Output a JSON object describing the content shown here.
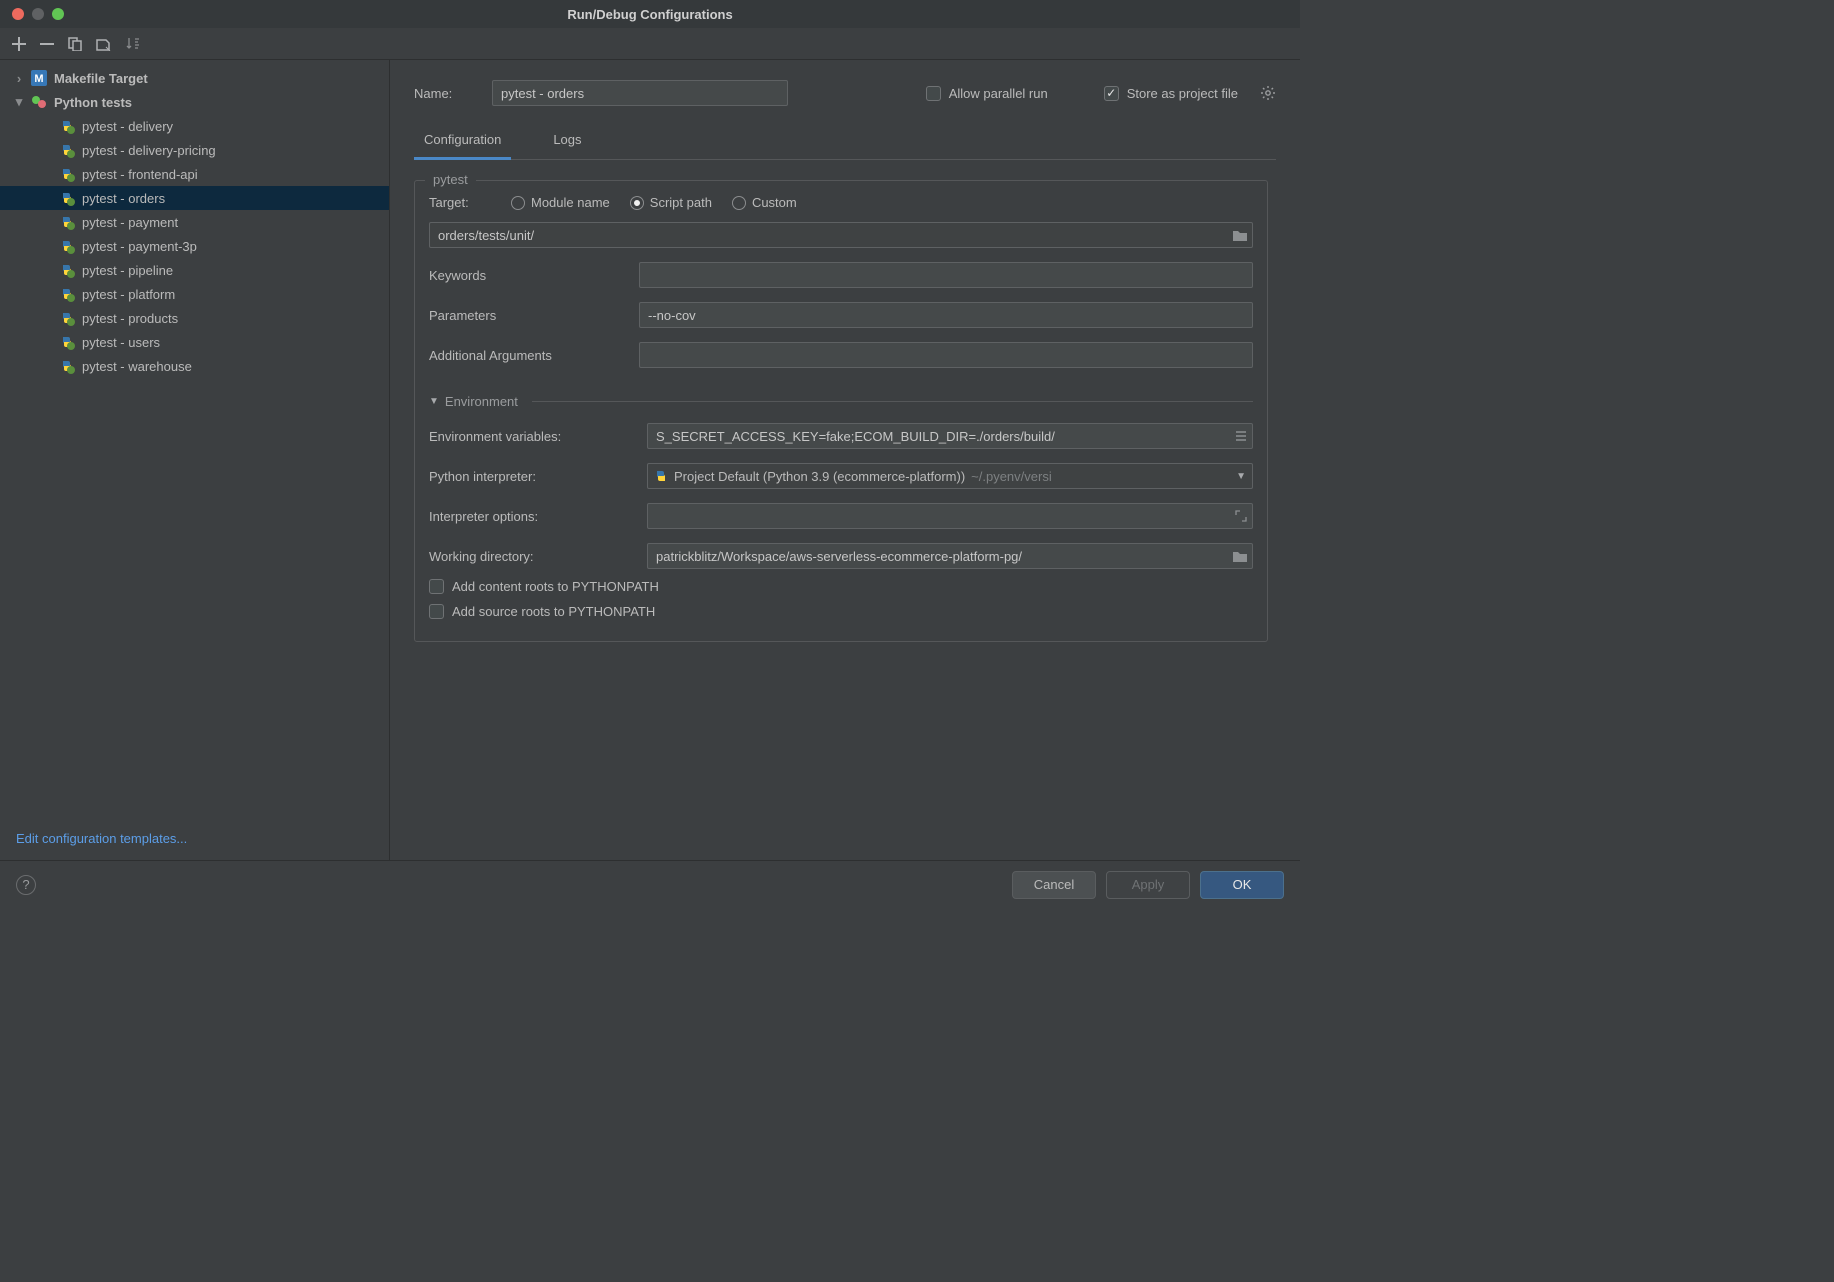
{
  "window": {
    "title": "Run/Debug Configurations"
  },
  "sidebar": {
    "groups": [
      {
        "label": "Makefile Target",
        "expanded": false,
        "icon": "makefile"
      },
      {
        "label": "Python tests",
        "expanded": true,
        "icon": "pytests",
        "items": [
          {
            "label": "pytest - delivery",
            "selected": false
          },
          {
            "label": "pytest - delivery-pricing",
            "selected": false
          },
          {
            "label": "pytest - frontend-api",
            "selected": false
          },
          {
            "label": "pytest - orders",
            "selected": true
          },
          {
            "label": "pytest - payment",
            "selected": false
          },
          {
            "label": "pytest - payment-3p",
            "selected": false
          },
          {
            "label": "pytest - pipeline",
            "selected": false
          },
          {
            "label": "pytest - platform",
            "selected": false
          },
          {
            "label": "pytest - products",
            "selected": false
          },
          {
            "label": "pytest - users",
            "selected": false
          },
          {
            "label": "pytest - warehouse",
            "selected": false
          }
        ]
      }
    ],
    "edit_templates": "Edit configuration templates..."
  },
  "name_row": {
    "label": "Name:",
    "value": "pytest - orders",
    "allow_parallel_label": "Allow parallel run",
    "allow_parallel_checked": false,
    "store_as_project_label": "Store as project file",
    "store_as_project_checked": true
  },
  "tabs": [
    {
      "label": "Configuration",
      "active": true
    },
    {
      "label": "Logs",
      "active": false
    }
  ],
  "pytest": {
    "group_title": "pytest",
    "target_label": "Target:",
    "target_options": [
      {
        "label": "Module name",
        "checked": false
      },
      {
        "label": "Script path",
        "checked": true
      },
      {
        "label": "Custom",
        "checked": false
      }
    ],
    "target_path": "orders/tests/unit/",
    "keywords_label": "Keywords",
    "keywords_value": "",
    "parameters_label": "Parameters",
    "parameters_value": "--no-cov",
    "additional_args_label": "Additional Arguments",
    "additional_args_value": ""
  },
  "environment": {
    "section_title": "Environment",
    "env_vars_label": "Environment variables:",
    "env_vars_value": "S_SECRET_ACCESS_KEY=fake;ECOM_BUILD_DIR=./orders/build/",
    "interpreter_label": "Python interpreter:",
    "interpreter_value": "Project Default (Python 3.9 (ecommerce-platform))",
    "interpreter_hint": "~/.pyenv/versi",
    "interpreter_options_label": "Interpreter options:",
    "interpreter_options_value": "",
    "working_dir_label": "Working directory:",
    "working_dir_value": "patrickblitz/Workspace/aws-serverless-ecommerce-platform-pg/",
    "add_content_roots_label": "Add content roots to PYTHONPATH",
    "add_content_roots_checked": false,
    "add_source_roots_label": "Add source roots to PYTHONPATH",
    "add_source_roots_checked": false
  },
  "footer": {
    "cancel": "Cancel",
    "apply": "Apply",
    "ok": "OK"
  }
}
